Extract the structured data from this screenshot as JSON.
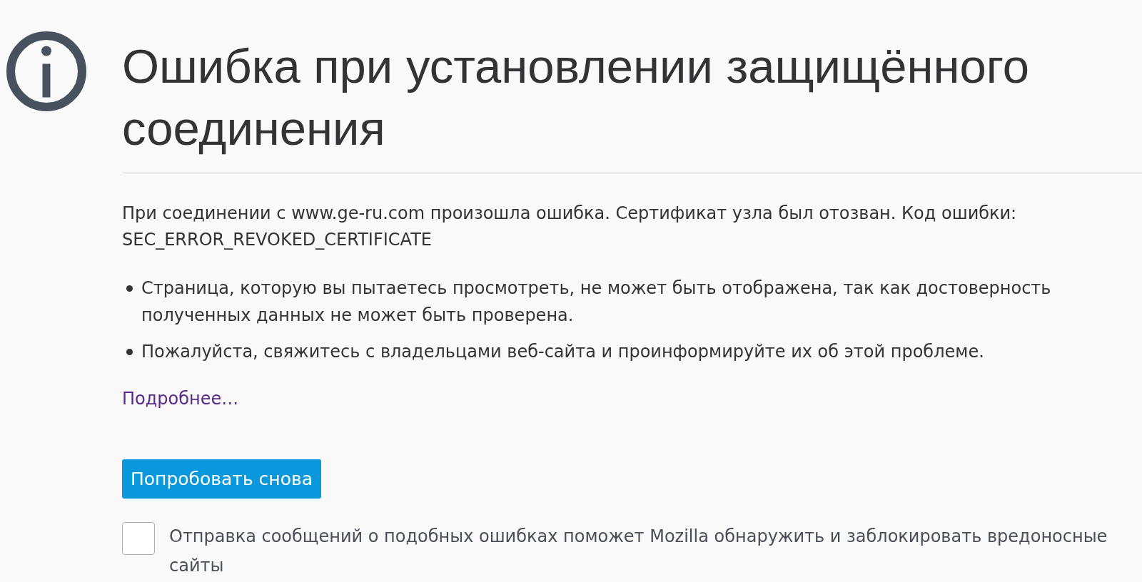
{
  "title": "Ошибка при установлении защищённого соединения",
  "description": "При соединении с www.ge-ru.com произошла ошибка. Сертификат узла был отозван. Код ошибки: SEC_ERROR_REVOKED_CERTIFICATE",
  "bullets": [
    "Страница, которую вы пытаетесь просмотреть, не может быть отображена, так как достоверность полученных данных не может быть проверена.",
    "Пожалуйста, свяжитесь с владельцами веб-сайта и проинформируйте их об этой проблеме."
  ],
  "advanced_link": "Подробнее…",
  "try_again_button": "Попробовать снова",
  "report_checkbox": {
    "label": "Отправка сообщений о подобных ошибках поможет Mozilla обнаружить и заблокировать вредоносные сайты",
    "checked": false
  }
}
